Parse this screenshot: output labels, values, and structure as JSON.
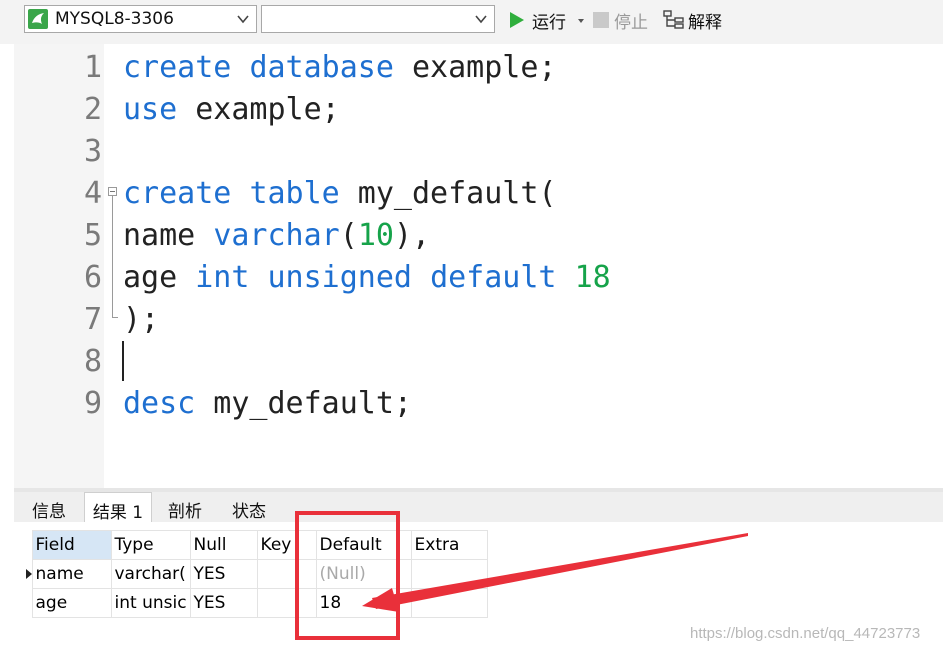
{
  "toolbar": {
    "connection": "MYSQL8-3306",
    "database": "",
    "run_label": "运行",
    "stop_label": "停止",
    "explain_label": "解释"
  },
  "editor": {
    "lines": [
      {
        "n": "1",
        "tokens": [
          {
            "t": "create",
            "c": "kw"
          },
          {
            "t": " "
          },
          {
            "t": "database",
            "c": "kw"
          },
          {
            "t": " example;"
          }
        ]
      },
      {
        "n": "2",
        "tokens": [
          {
            "t": "use",
            "c": "kw"
          },
          {
            "t": " example;"
          }
        ]
      },
      {
        "n": "3",
        "tokens": []
      },
      {
        "n": "4",
        "tokens": [
          {
            "t": "create",
            "c": "kw"
          },
          {
            "t": " "
          },
          {
            "t": "table",
            "c": "kw"
          },
          {
            "t": " my_default("
          }
        ]
      },
      {
        "n": "5",
        "tokens": [
          {
            "t": "name "
          },
          {
            "t": "varchar",
            "c": "kw"
          },
          {
            "t": "("
          },
          {
            "t": "10",
            "c": "num"
          },
          {
            "t": "),"
          }
        ]
      },
      {
        "n": "6",
        "tokens": [
          {
            "t": "age "
          },
          {
            "t": "int",
            "c": "kw"
          },
          {
            "t": " "
          },
          {
            "t": "unsigned",
            "c": "kw"
          },
          {
            "t": " "
          },
          {
            "t": "default",
            "c": "kw"
          },
          {
            "t": " "
          },
          {
            "t": "18",
            "c": "num"
          }
        ]
      },
      {
        "n": "7",
        "tokens": [
          {
            "t": ");"
          }
        ]
      },
      {
        "n": "8",
        "tokens": []
      },
      {
        "n": "9",
        "tokens": [
          {
            "t": "desc",
            "c": "kw"
          },
          {
            "t": " my_default;"
          }
        ]
      }
    ]
  },
  "tabs": [
    {
      "label": "信息",
      "active": false
    },
    {
      "label": "结果 1",
      "active": true
    },
    {
      "label": "剖析",
      "active": false
    },
    {
      "label": "状态",
      "active": false
    }
  ],
  "results": {
    "columns": [
      "Field",
      "Type",
      "Null",
      "Key",
      "Default",
      "Extra"
    ],
    "rows": [
      [
        "name",
        "varchar(",
        "YES",
        "",
        "(Null)",
        ""
      ],
      [
        "age",
        "int unsic",
        "YES",
        "",
        "18",
        ""
      ]
    ]
  },
  "watermark": "https://blog.csdn.net/qq_44723773",
  "colors": {
    "keyword": "#1e6fd0",
    "number": "#16a34a",
    "highlight": "#e9303a"
  }
}
